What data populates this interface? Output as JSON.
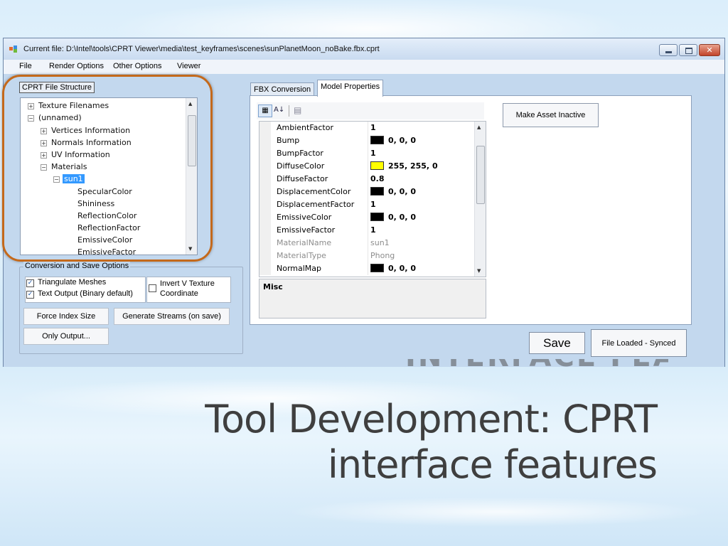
{
  "window": {
    "title": "Current file: D:\\Intel\\tools\\CPRT Viewer\\media\\test_keyframes\\scenes\\sunPlanetMoon_noBake.fbx.cprt",
    "close_glyph": "✕"
  },
  "menu": {
    "items": [
      "File",
      "Render Options",
      "Other Options",
      "Viewer"
    ]
  },
  "file_structure": {
    "label": "CPRT File Structure",
    "items": [
      {
        "label": "Texture Filenames",
        "expander": "+"
      },
      {
        "label": "(unnamed)",
        "expander": "−"
      },
      {
        "label": "Vertices Information",
        "expander": "+"
      },
      {
        "label": "Normals Information",
        "expander": "+"
      },
      {
        "label": "UV Information",
        "expander": "+"
      },
      {
        "label": "Materials",
        "expander": "−"
      },
      {
        "label": "sun1",
        "expander": "−"
      },
      {
        "label": "SpecularColor"
      },
      {
        "label": "Shininess"
      },
      {
        "label": "ReflectionColor"
      },
      {
        "label": "ReflectionFactor"
      },
      {
        "label": "EmissiveColor"
      },
      {
        "label": "EmissiveFactor"
      }
    ]
  },
  "conversion": {
    "label": "Conversion and Save Options",
    "triangulate": {
      "label": "Triangulate Meshes",
      "checked": true
    },
    "text_output": {
      "label": "Text Output (Binary default)",
      "checked": true
    },
    "invert_v": {
      "label_line1": "Invert V Texture",
      "label_line2": "Coordinate",
      "checked": false
    },
    "check_glyph": "✓",
    "force_index_label": "Force Index Size",
    "generate_streams_label": "Generate Streams (on save)",
    "only_output_label": "Only Output..."
  },
  "tabs": [
    {
      "label": "FBX Conversion",
      "active": false
    },
    {
      "label": "Model Properties",
      "active": true
    }
  ],
  "property_grid": {
    "sort_glyphs": {
      "categorized": "▦",
      "alphabetical": "A↓",
      "pages": "▤"
    },
    "rows": [
      {
        "name": "AmbientFactor",
        "value": "1"
      },
      {
        "name": "Bump",
        "value": "0, 0, 0",
        "swatch": "#000000"
      },
      {
        "name": "BumpFactor",
        "value": "1"
      },
      {
        "name": "DiffuseColor",
        "value": "255, 255, 0",
        "swatch": "#ffff00"
      },
      {
        "name": "DiffuseFactor",
        "value": "0.8"
      },
      {
        "name": "DisplacementColor",
        "value": "0, 0, 0",
        "swatch": "#000000"
      },
      {
        "name": "DisplacementFactor",
        "value": "1"
      },
      {
        "name": "EmissiveColor",
        "value": "0, 0, 0",
        "swatch": "#000000"
      },
      {
        "name": "EmissiveFactor",
        "value": "1"
      },
      {
        "name": "MaterialName",
        "value": "sun1",
        "readonly": true
      },
      {
        "name": "MaterialType",
        "value": "Phong",
        "readonly": true
      },
      {
        "name": "NormalMap",
        "value": "0, 0, 0",
        "swatch": "#000000"
      }
    ],
    "description_title": "Misc"
  },
  "buttons": {
    "make_inactive": "Make Asset Inactive",
    "save": "Save",
    "status": "File Loaded - Synced"
  },
  "slide": {
    "title_line1": "Tool Development: CPRT",
    "title_line2": "interface features",
    "reflection_text": "INTERFACE FEATURES"
  },
  "colors": {
    "highlight_ring": "#c4691b",
    "selection": "#3399ff"
  }
}
